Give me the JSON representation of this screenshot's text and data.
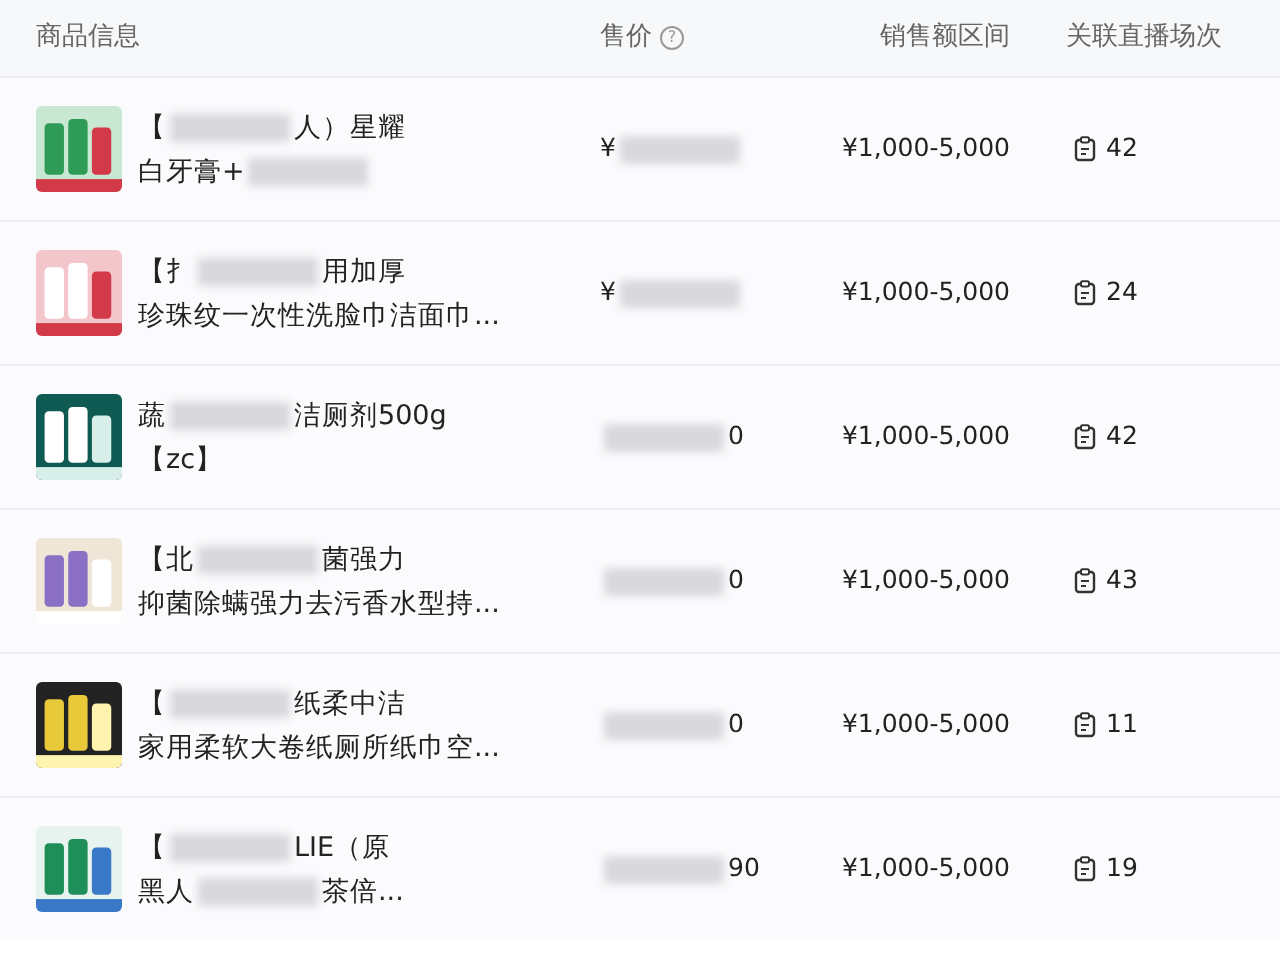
{
  "columns": [
    {
      "label": "商品信息"
    },
    {
      "label": "售价",
      "help": "?"
    },
    {
      "label": "销售额区间"
    },
    {
      "label": "关联直播场次"
    }
  ],
  "rows": [
    {
      "lines": [
        [
          {
            "text": "【"
          },
          {
            "kind": "blur"
          },
          {
            "text": "人）星耀"
          }
        ],
        [
          {
            "text": "白牙膏+"
          },
          {
            "kind": "blur"
          }
        ]
      ],
      "price": [
        {
          "text": "¥"
        },
        {
          "kind": "blur"
        }
      ],
      "range": "¥1,000-5,000",
      "sessions": "42"
    },
    {
      "lines": [
        [
          {
            "text": "【扌"
          },
          {
            "kind": "blur"
          },
          {
            "text": "用加厚"
          }
        ],
        [
          {
            "text": "珍珠纹一次性洗脸巾洁面巾..."
          }
        ]
      ],
      "price": [
        {
          "text": "¥"
        },
        {
          "kind": "blur"
        }
      ],
      "range": "¥1,000-5,000",
      "sessions": "24"
    },
    {
      "lines": [
        [
          {
            "text": "蔬"
          },
          {
            "kind": "blur"
          },
          {
            "text": "洁厕剂500g"
          }
        ],
        [
          {
            "text": "【zc】"
          }
        ]
      ],
      "price": [
        {
          "kind": "blur"
        },
        {
          "text": "0"
        }
      ],
      "range": "¥1,000-5,000",
      "sessions": "42"
    },
    {
      "lines": [
        [
          {
            "text": "【北"
          },
          {
            "kind": "blur"
          },
          {
            "text": "菌强力"
          }
        ],
        [
          {
            "text": "抑菌除螨强力去污香水型持..."
          }
        ]
      ],
      "price": [
        {
          "kind": "blur"
        },
        {
          "text": "0"
        }
      ],
      "range": "¥1,000-5,000",
      "sessions": "43"
    },
    {
      "lines": [
        [
          {
            "text": "【"
          },
          {
            "kind": "blur"
          },
          {
            "text": "纸柔中洁"
          }
        ],
        [
          {
            "text": "家用柔软大卷纸厕所纸巾空..."
          }
        ]
      ],
      "price": [
        {
          "kind": "blur"
        },
        {
          "text": "0"
        }
      ],
      "range": "¥1,000-5,000",
      "sessions": "11"
    },
    {
      "lines": [
        [
          {
            "text": "【"
          },
          {
            "kind": "blur"
          },
          {
            "text": "LIE（原"
          }
        ],
        [
          {
            "text": "黑人"
          },
          {
            "kind": "blur"
          },
          {
            "text": "茶倍..."
          }
        ]
      ],
      "price": [
        {
          "kind": "blur"
        },
        {
          "text": "90"
        }
      ],
      "range": "¥1,000-5,000",
      "sessions": "19"
    }
  ]
}
